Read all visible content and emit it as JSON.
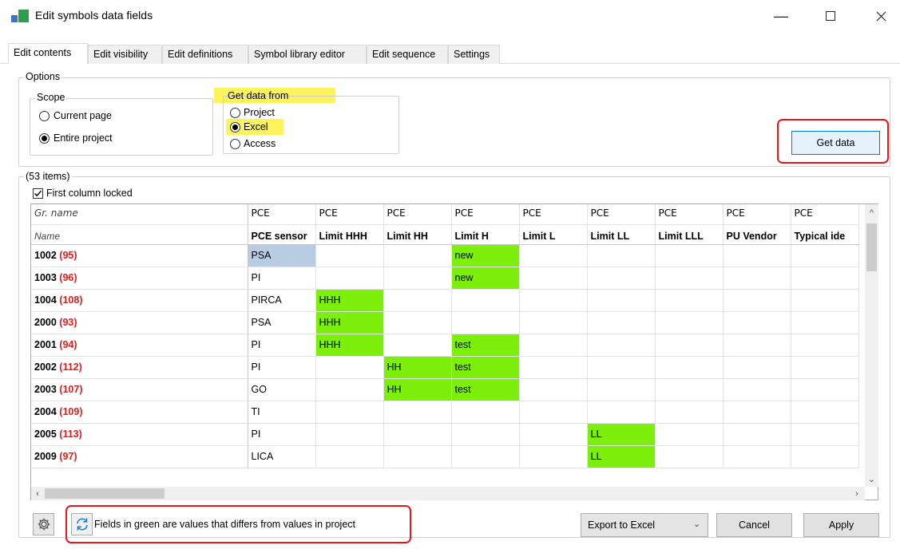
{
  "window": {
    "title": "Edit symbols data fields"
  },
  "tabs": [
    {
      "label": "Edit contents",
      "active": true
    },
    {
      "label": "Edit visibility"
    },
    {
      "label": "Edit definitions"
    },
    {
      "label": "Symbol library editor"
    },
    {
      "label": "Edit sequence"
    },
    {
      "label": "Settings"
    }
  ],
  "options": {
    "legend": "Options",
    "scope": {
      "legend": "Scope",
      "items": [
        {
          "label": "Current page",
          "checked": false
        },
        {
          "label": "Entire project",
          "checked": true
        }
      ]
    },
    "source": {
      "legend": "Get data from",
      "items": [
        {
          "label": "Project",
          "checked": false
        },
        {
          "label": "Excel",
          "checked": true
        },
        {
          "label": "Access",
          "checked": false
        }
      ]
    },
    "get_data_label": "Get data"
  },
  "items": {
    "legend": "(53 items)",
    "first_col_locked_label": "First column locked",
    "first_col_locked": true
  },
  "grid": {
    "group_row_label": "Gr. name",
    "name_row_label": "Name",
    "columns": [
      {
        "group": "PCE",
        "name": "PCE sensor"
      },
      {
        "group": "PCE",
        "name": "Limit HHH"
      },
      {
        "group": "PCE",
        "name": "Limit HH"
      },
      {
        "group": "PCE",
        "name": "Limit H"
      },
      {
        "group": "PCE",
        "name": "Limit L"
      },
      {
        "group": "PCE",
        "name": "Limit LL"
      },
      {
        "group": "PCE",
        "name": "Limit LLL"
      },
      {
        "group": "PCE",
        "name": "PU Vendor"
      },
      {
        "group": "PCE",
        "name": "Typical ide"
      }
    ],
    "rows": [
      {
        "id": "1002",
        "count": "(95)",
        "cells": [
          "PSA",
          "",
          "",
          "new",
          "",
          "",
          "",
          "",
          ""
        ]
      },
      {
        "id": "1003",
        "count": "(96)",
        "cells": [
          "PI",
          "",
          "",
          "new",
          "",
          "",
          "",
          "",
          ""
        ]
      },
      {
        "id": "1004",
        "count": "(108)",
        "cells": [
          "PIRCA",
          "HHH",
          "",
          "",
          "",
          "",
          "",
          "",
          ""
        ]
      },
      {
        "id": "2000",
        "count": "(93)",
        "cells": [
          "PSA",
          "HHH",
          "",
          "",
          "",
          "",
          "",
          "",
          ""
        ]
      },
      {
        "id": "2001",
        "count": "(94)",
        "cells": [
          "PI",
          "HHH",
          "",
          "test",
          "",
          "",
          "",
          "",
          ""
        ]
      },
      {
        "id": "2002",
        "count": "(112)",
        "cells": [
          "PI",
          "",
          "HH",
          "test",
          "",
          "",
          "",
          "",
          ""
        ]
      },
      {
        "id": "2003",
        "count": "(107)",
        "cells": [
          "GO",
          "",
          "HH",
          "test",
          "",
          "",
          "",
          "",
          ""
        ]
      },
      {
        "id": "2004",
        "count": "(109)",
        "cells": [
          "TI",
          "",
          "",
          "",
          "",
          "",
          "",
          "",
          ""
        ]
      },
      {
        "id": "2005",
        "count": "(113)",
        "cells": [
          "PI",
          "",
          "",
          "",
          "",
          "LL",
          "",
          "",
          ""
        ]
      },
      {
        "id": "2009",
        "count": "(97)",
        "cells": [
          "LICA",
          "",
          "",
          "",
          "",
          "LL",
          "",
          "",
          ""
        ]
      }
    ],
    "selected_cell": {
      "row": 0,
      "col": 0
    }
  },
  "footer": {
    "info_text": "Fields in green are values that differs from values in project",
    "export_select": "Export to Excel",
    "cancel_label": "Cancel",
    "apply_label": "Apply"
  },
  "colors": {
    "changed_cell": "#7cf00b",
    "selected_cell": "#b8cce4",
    "count_red": "#e11d1d",
    "highlight": "#fdf35b",
    "callout_red": "#e8151b",
    "accent": "#0078d7"
  },
  "icons": {
    "app": "app-icon",
    "minimize": "minimize-icon",
    "maximize": "maximize-icon",
    "close": "close-icon",
    "settings": "gear-icon",
    "refresh": "refresh-icon"
  }
}
